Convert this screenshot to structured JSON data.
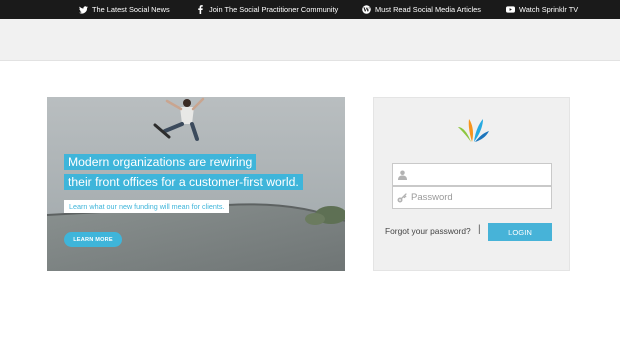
{
  "topnav": {
    "items": [
      {
        "icon": "twitter-icon",
        "label": "The Latest Social News"
      },
      {
        "icon": "facebook-icon",
        "label": "Join The Social Practitioner Community"
      },
      {
        "icon": "wordpress-icon",
        "label": "Must Read Social Media Articles"
      },
      {
        "icon": "youtube-icon",
        "label": "Watch Sprinklr TV"
      }
    ]
  },
  "hero": {
    "headline_line1": "Modern organizations are rewiring",
    "headline_line2": "their front offices for a customer-first world.",
    "subtext": "Learn what our new funding will mean for clients.",
    "cta_label": "LEARN MORE"
  },
  "login": {
    "username": {
      "placeholder": "",
      "value": ""
    },
    "password": {
      "placeholder": "Password",
      "value": ""
    },
    "forgot_label": "Forgot your password?",
    "separator": "|",
    "login_label": "LOGIN"
  },
  "colors": {
    "accent": "#3fb5da",
    "topbar": "#1a1a1a",
    "logo_petals": [
      "#8dc63f",
      "#f7941d",
      "#27aae1",
      "#1c75bc"
    ]
  }
}
